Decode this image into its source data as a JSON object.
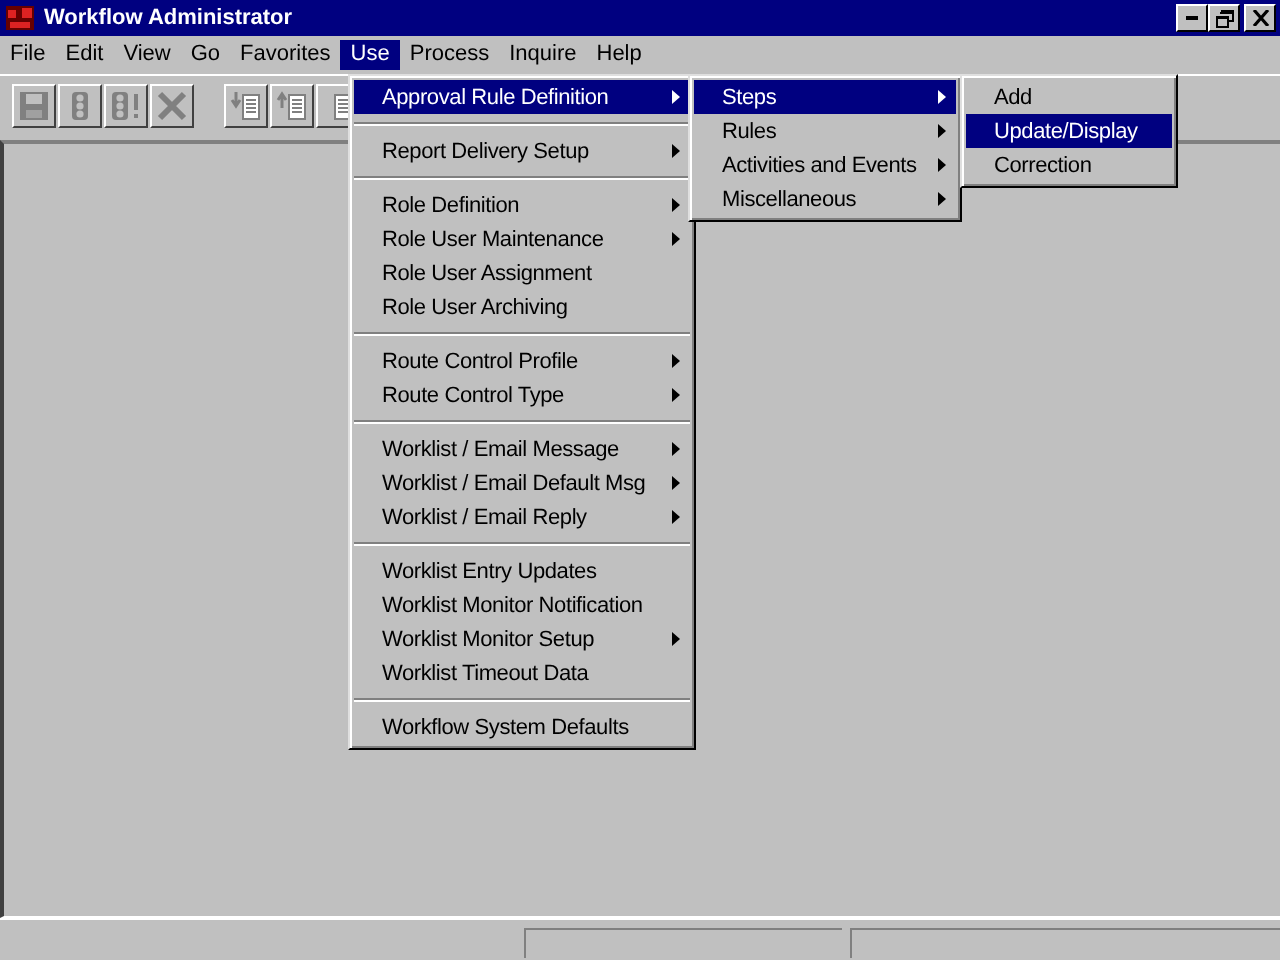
{
  "window": {
    "title": "Workflow Administrator"
  },
  "menubar": [
    {
      "label": "File",
      "selected": false
    },
    {
      "label": "Edit",
      "selected": false
    },
    {
      "label": "View",
      "selected": false
    },
    {
      "label": "Go",
      "selected": false
    },
    {
      "label": "Favorites",
      "selected": false
    },
    {
      "label": "Use",
      "selected": true
    },
    {
      "label": "Process",
      "selected": false
    },
    {
      "label": "Inquire",
      "selected": false
    },
    {
      "label": "Help",
      "selected": false
    }
  ],
  "toolbar": [
    {
      "kind": "save"
    },
    {
      "kind": "traffic"
    },
    {
      "kind": "traffic-alert"
    },
    {
      "kind": "delete"
    },
    {
      "kind": "spacer"
    },
    {
      "kind": "doc-down"
    },
    {
      "kind": "doc-up"
    },
    {
      "kind": "doc"
    }
  ],
  "menus": [
    {
      "items": [
        {
          "kind": "item",
          "label": "Approval Rule Definition",
          "submenu": true,
          "selected": true
        },
        {
          "kind": "separator"
        },
        {
          "kind": "item",
          "label": "Report Delivery Setup",
          "submenu": true,
          "selected": false
        },
        {
          "kind": "separator"
        },
        {
          "kind": "item",
          "label": "Role Definition",
          "submenu": true,
          "selected": false
        },
        {
          "kind": "item",
          "label": "Role User Maintenance",
          "submenu": true,
          "selected": false
        },
        {
          "kind": "item",
          "label": "Role User Assignment",
          "submenu": false,
          "selected": false
        },
        {
          "kind": "item",
          "label": "Role User Archiving",
          "submenu": false,
          "selected": false
        },
        {
          "kind": "separator"
        },
        {
          "kind": "item",
          "label": "Route Control Profile",
          "submenu": true,
          "selected": false
        },
        {
          "kind": "item",
          "label": "Route Control Type",
          "submenu": true,
          "selected": false
        },
        {
          "kind": "separator"
        },
        {
          "kind": "item",
          "label": "Worklist / Email Message",
          "submenu": true,
          "selected": false
        },
        {
          "kind": "item",
          "label": "Worklist / Email Default Msg",
          "submenu": true,
          "selected": false
        },
        {
          "kind": "item",
          "label": "Worklist / Email Reply",
          "submenu": true,
          "selected": false
        },
        {
          "kind": "separator"
        },
        {
          "kind": "item",
          "label": "Worklist Entry Updates",
          "submenu": false,
          "selected": false
        },
        {
          "kind": "item",
          "label": "Worklist Monitor Notification",
          "submenu": false,
          "selected": false
        },
        {
          "kind": "item",
          "label": "Worklist Monitor Setup",
          "submenu": true,
          "selected": false
        },
        {
          "kind": "item",
          "label": "Worklist Timeout Data",
          "submenu": false,
          "selected": false
        },
        {
          "kind": "separator"
        },
        {
          "kind": "item",
          "label": "Workflow System Defaults",
          "submenu": false,
          "selected": false
        }
      ]
    },
    {
      "items": [
        {
          "kind": "item",
          "label": "Steps",
          "submenu": true,
          "selected": true
        },
        {
          "kind": "item",
          "label": "Rules",
          "submenu": true,
          "selected": false
        },
        {
          "kind": "item",
          "label": "Activities and Events",
          "submenu": true,
          "selected": false
        },
        {
          "kind": "item",
          "label": "Miscellaneous",
          "submenu": true,
          "selected": false
        }
      ]
    },
    {
      "items": [
        {
          "kind": "item",
          "label": "Add",
          "submenu": false,
          "selected": false
        },
        {
          "kind": "item",
          "label": "Update/Display",
          "submenu": false,
          "selected": true
        },
        {
          "kind": "item",
          "label": "Correction",
          "submenu": false,
          "selected": false
        }
      ]
    }
  ]
}
